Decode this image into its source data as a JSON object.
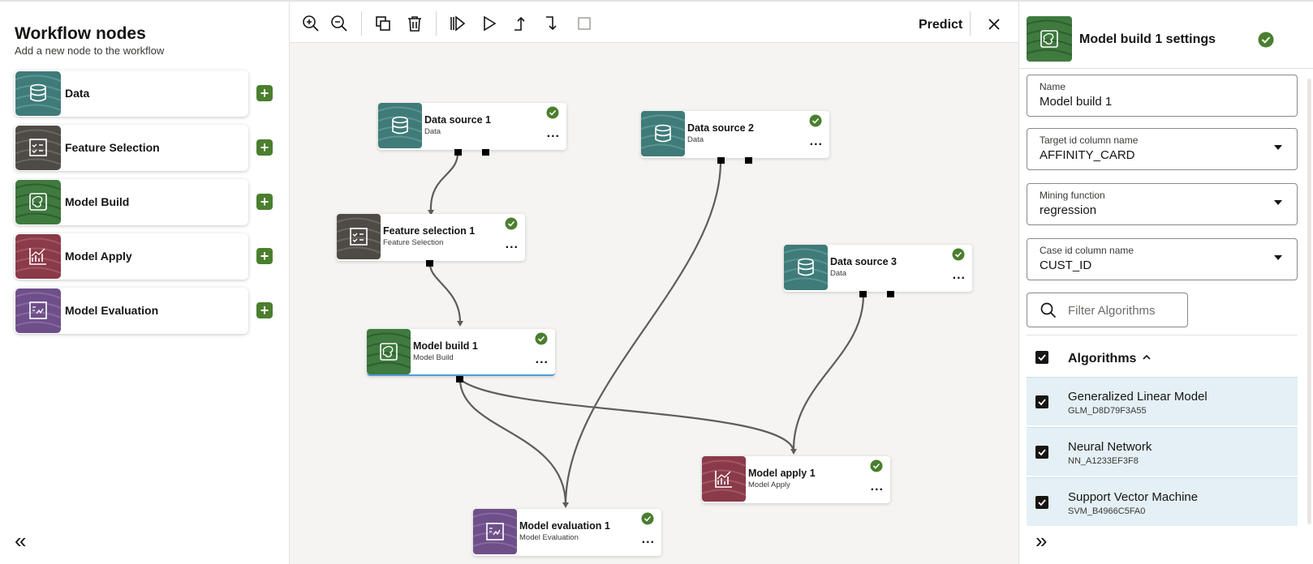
{
  "colors": {
    "data": "#3f7b78",
    "feature_selection": "#4e4a45",
    "model_build": "#3f7a3f",
    "model_apply": "#8a3a48",
    "model_evaluation": "#6e4f8a",
    "success": "#4a7f2e",
    "accent_selected": "#4c9ed6",
    "algo_row_bg": "#e4f0f5"
  },
  "left_panel": {
    "title": "Workflow nodes",
    "subtitle": "Add a new node to the workflow",
    "items": [
      {
        "label": "Data",
        "icon": "database-icon"
      },
      {
        "label": "Feature Selection",
        "icon": "checklist-icon"
      },
      {
        "label": "Model Build",
        "icon": "brain-icon"
      },
      {
        "label": "Model Apply",
        "icon": "chart-icon"
      },
      {
        "label": "Model Evaluation",
        "icon": "evaluation-icon"
      }
    ],
    "add_symbol": "+",
    "collapse_symbol": "«"
  },
  "toolbar": {
    "icons": [
      "zoom-in-icon",
      "zoom-out-icon",
      "duplicate-icon",
      "delete-icon",
      "run-all-icon",
      "run-icon",
      "run-parents-icon",
      "run-children-icon",
      "stop-icon"
    ],
    "predict_label": "Predict",
    "close_icon": "close-icon"
  },
  "nodes": [
    {
      "title": "Data source 1",
      "type": "Data"
    },
    {
      "title": "Data source 2",
      "type": "Data"
    },
    {
      "title": "Feature selection 1",
      "type": "Feature Selection"
    },
    {
      "title": "Data source 3",
      "type": "Data"
    },
    {
      "title": "Model build 1",
      "type": "Model Build"
    },
    {
      "title": "Model apply 1",
      "type": "Model Apply"
    },
    {
      "title": "Model evaluation 1",
      "type": "Model Evaluation"
    }
  ],
  "node_more": "...",
  "settings": {
    "title": "Model build 1 settings",
    "fields": {
      "name": {
        "label": "Name",
        "value": "Model build 1"
      },
      "target": {
        "label": "Target id column name",
        "value": "AFFINITY_CARD"
      },
      "mining": {
        "label": "Mining function",
        "value": "regression"
      },
      "case": {
        "label": "Case id column name",
        "value": "CUST_ID"
      }
    },
    "filter_placeholder": "Filter Algorithms",
    "algorithms_header": "Algorithms",
    "algorithms": [
      {
        "name": "Generalized Linear Model",
        "id": "GLM_D8D79F3A55"
      },
      {
        "name": "Neural Network",
        "id": "NN_A1233EF3F8"
      },
      {
        "name": "Support Vector Machine",
        "id": "SVM_B4966C5FA0"
      }
    ],
    "expand_symbol": "»"
  }
}
